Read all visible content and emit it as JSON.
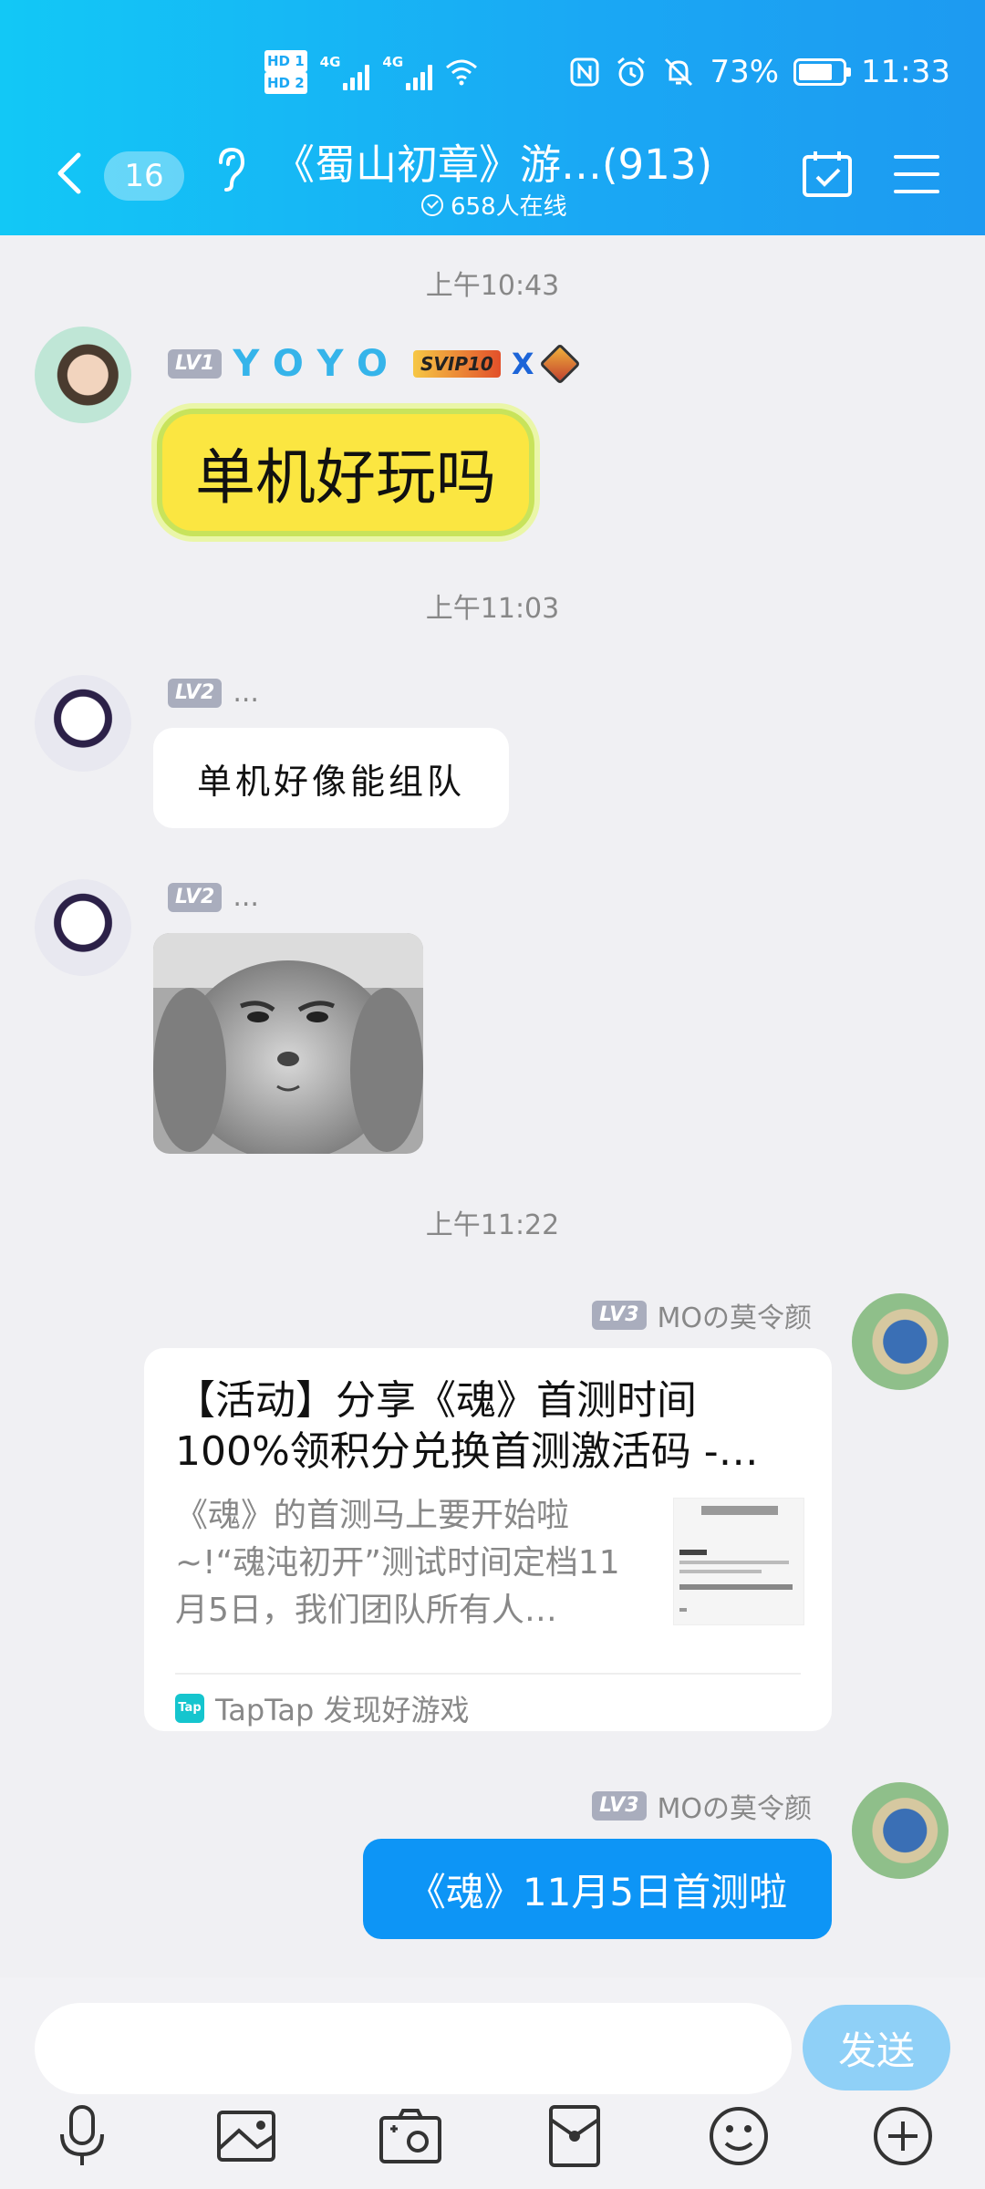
{
  "status_bar": {
    "sim1": "HD 1",
    "sim2": "HD 2",
    "net1": "4G",
    "net2": "4G",
    "battery_percent": "73%",
    "time": "11:33"
  },
  "header": {
    "unread_count": "16",
    "group_title": "《蜀山初章》游…(913)",
    "online_text": "658人在线"
  },
  "messages": {
    "ts1": "上午10:43",
    "m1": {
      "level": "LV1",
      "nickname": "YOYO",
      "vip": "SVIP10",
      "vip_x": "X",
      "text": "单机好玩吗"
    },
    "ts2": "上午11:03",
    "m2": {
      "level": "LV2",
      "nickname": "...",
      "text": "单机好像能组队"
    },
    "m3": {
      "level": "LV2",
      "nickname": "..."
    },
    "ts3": "上午11:22",
    "m4": {
      "level": "LV3",
      "nickname": "MOの莫令颜",
      "card_title": "【活动】分享《魂》首测时间100%领积分兑换首测激活码 -…",
      "card_desc": "《魂》的首测马上要开始啦~!“魂沌初开”测试时间定档11月5日，我们团队所有人…",
      "card_source": "TapTap 发现好游戏",
      "tap_logo": "Tap"
    },
    "m5": {
      "level": "LV3",
      "nickname": "MOの莫令颜",
      "text": "《魂》11月5日首测啦"
    }
  },
  "input": {
    "placeholder": "",
    "send_label": "发送"
  },
  "toolbar_icons": [
    "microphone-icon",
    "photo-icon",
    "camera-icon",
    "red-packet-icon",
    "emoji-icon",
    "plus-icon"
  ]
}
